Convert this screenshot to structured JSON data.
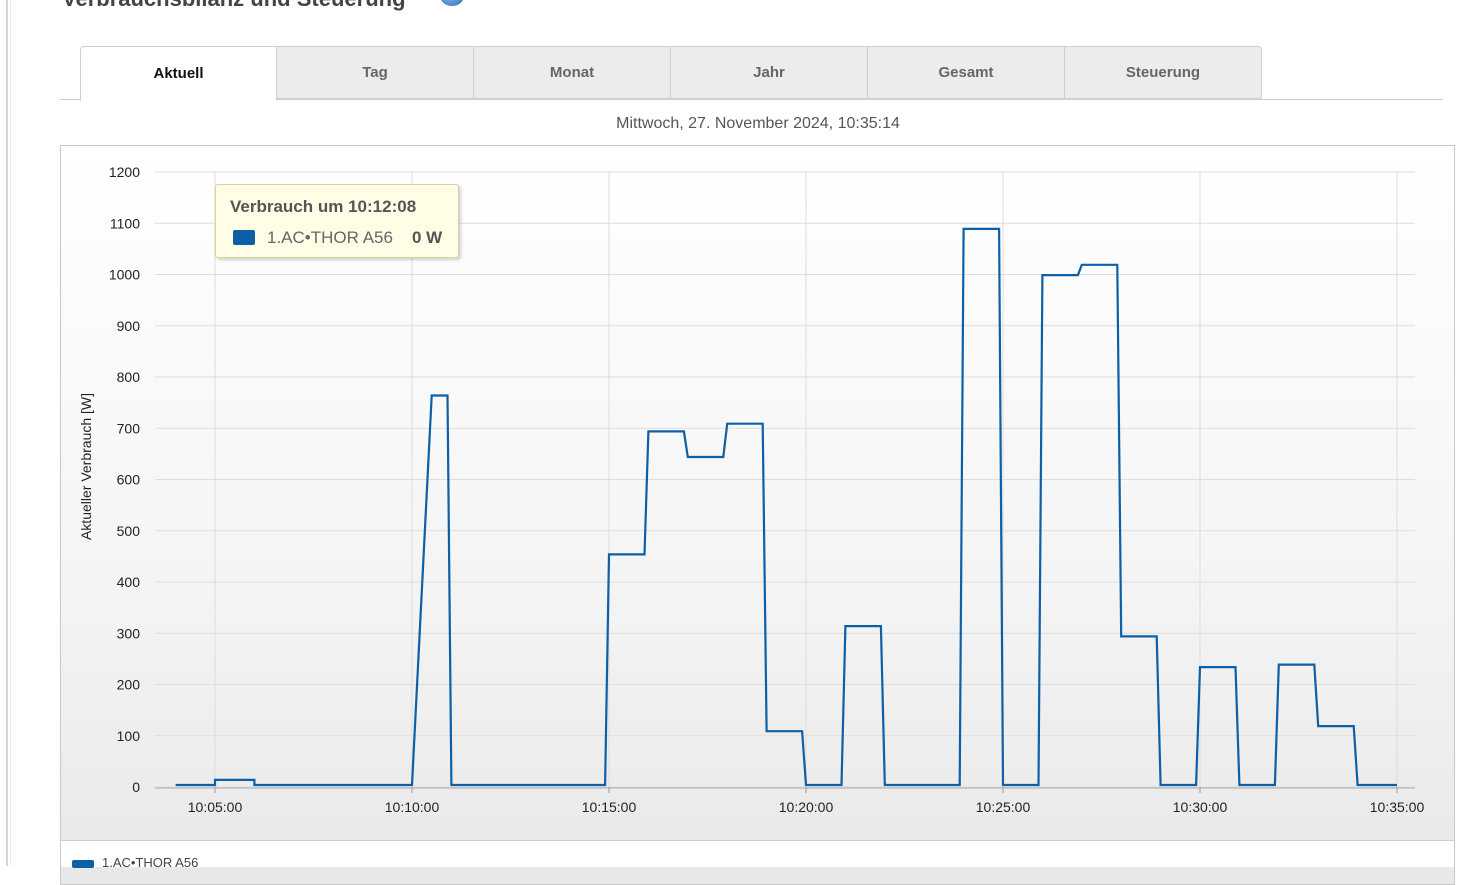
{
  "page": {
    "title": "Verbrauchsbilanz und Steuerung"
  },
  "tabs": [
    {
      "label": "Aktuell",
      "active": true
    },
    {
      "label": "Tag",
      "active": false
    },
    {
      "label": "Monat",
      "active": false
    },
    {
      "label": "Jahr",
      "active": false
    },
    {
      "label": "Gesamt",
      "active": false
    },
    {
      "label": "Steuerung",
      "active": false
    }
  ],
  "date_line": "Mittwoch, 27. November 2024, 10:35:14",
  "tooltip": {
    "title": "Verbrauch um 10:12:08",
    "series": "1.AC•THOR A56",
    "value": "0 W"
  },
  "legend": {
    "label": "1.AC•THOR A56"
  },
  "colors": {
    "series": "#0d5fa6",
    "grid": "#dddddd",
    "tab_bg": "#ececec"
  },
  "chart_data": {
    "type": "line",
    "ylabel": "Aktueller Verbrauch [W]",
    "ylim": [
      0,
      1200
    ],
    "yticks": [
      0,
      100,
      200,
      300,
      400,
      500,
      600,
      700,
      800,
      900,
      1000,
      1100,
      1200
    ],
    "xticks": [
      "10:05:00",
      "10:10:00",
      "10:15:00",
      "10:20:00",
      "10:25:00",
      "10:30:00",
      "10:35:00"
    ],
    "grid": true,
    "series": [
      {
        "name": "1.AC•THOR A56",
        "x": [
          "10:04:00",
          "10:05:00",
          "10:05:00",
          "10:06:00",
          "10:06:00",
          "10:10:00",
          "10:10:30",
          "10:10:54",
          "10:11:00",
          "10:14:54",
          "10:15:00",
          "10:15:54",
          "10:16:00",
          "10:16:54",
          "10:17:00",
          "10:17:54",
          "10:18:00",
          "10:18:54",
          "10:19:00",
          "10:19:54",
          "10:20:00",
          "10:20:54",
          "10:21:00",
          "10:21:54",
          "10:22:00",
          "10:23:54",
          "10:24:00",
          "10:24:54",
          "10:25:00",
          "10:25:54",
          "10:26:00",
          "10:26:54",
          "10:27:00",
          "10:27:54",
          "10:28:00",
          "10:28:54",
          "10:29:00",
          "10:29:54",
          "10:30:00",
          "10:30:54",
          "10:31:00",
          "10:31:54",
          "10:32:00",
          "10:32:54",
          "10:33:00",
          "10:33:54",
          "10:34:00",
          "10:35:00"
        ],
        "y": [
          0,
          0,
          10,
          10,
          0,
          0,
          760,
          760,
          0,
          0,
          450,
          450,
          690,
          690,
          640,
          640,
          705,
          705,
          105,
          105,
          0,
          0,
          310,
          310,
          0,
          0,
          1085,
          1085,
          0,
          0,
          995,
          995,
          1015,
          1015,
          290,
          290,
          0,
          0,
          230,
          230,
          0,
          0,
          235,
          235,
          115,
          115,
          0,
          0
        ]
      }
    ]
  }
}
